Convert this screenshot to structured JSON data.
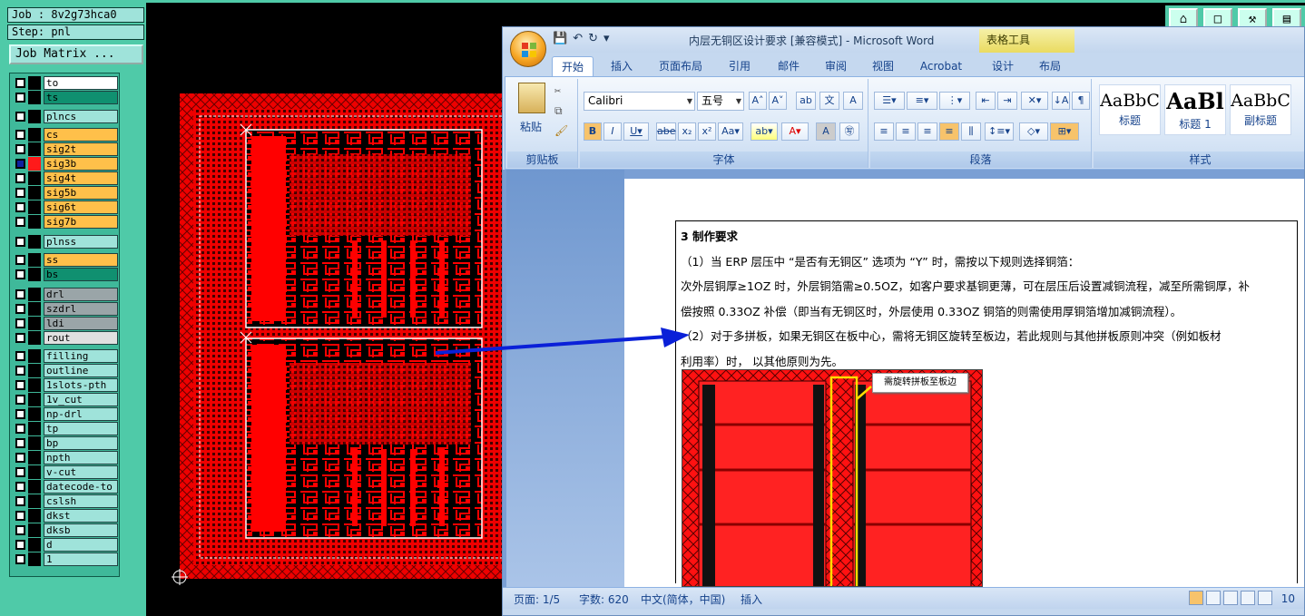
{
  "cam": {
    "job_label": "Job : 8v2g73hca0",
    "step_label": "Step: pnl",
    "job_matrix_label": "Job Matrix ...",
    "layers": [
      {
        "name": "to",
        "color": "#ffffff"
      },
      {
        "name": "ts",
        "color": "#109070"
      },
      {
        "name": "plncs",
        "color": "#9fe3da"
      },
      {
        "name": "cs",
        "color": "#ffc04a"
      },
      {
        "name": "sig2t",
        "color": "#ffc04a"
      },
      {
        "name": "sig3b",
        "color": "#ffc04a"
      },
      {
        "name": "sig4t",
        "color": "#ffc04a"
      },
      {
        "name": "sig5b",
        "color": "#ffc04a"
      },
      {
        "name": "sig6t",
        "color": "#ffc04a"
      },
      {
        "name": "sig7b",
        "color": "#ffc04a"
      },
      {
        "name": "plnss",
        "color": "#9fe3da"
      },
      {
        "name": "ss",
        "color": "#ffc04a"
      },
      {
        "name": "bs",
        "color": "#109070"
      },
      {
        "name": "drl",
        "color": "#9aa5a8"
      },
      {
        "name": "szdrl",
        "color": "#9aa5a8"
      },
      {
        "name": "ldi",
        "color": "#9aa5a8"
      },
      {
        "name": "rout",
        "color": "#e0e0e0"
      },
      {
        "name": "filling",
        "color": "#9fe3da"
      },
      {
        "name": "outline",
        "color": "#9fe3da"
      },
      {
        "name": "1slots-pth",
        "color": "#9fe3da"
      },
      {
        "name": "1v_cut",
        "color": "#9fe3da"
      },
      {
        "name": "np-drl",
        "color": "#9fe3da"
      },
      {
        "name": "tp",
        "color": "#9fe3da"
      },
      {
        "name": "bp",
        "color": "#9fe3da"
      },
      {
        "name": "npth",
        "color": "#9fe3da"
      },
      {
        "name": "v-cut",
        "color": "#9fe3da"
      },
      {
        "name": "datecode-to",
        "color": "#9fe3da"
      },
      {
        "name": "cslsh",
        "color": "#9fe3da"
      },
      {
        "name": "dkst",
        "color": "#9fe3da"
      },
      {
        "name": "dksb",
        "color": "#9fe3da"
      },
      {
        "name": "d",
        "color": "#9fe3da"
      },
      {
        "name": "1",
        "color": "#9fe3da"
      }
    ],
    "selected_layer": "sig3b"
  },
  "word": {
    "window_title": "内层无铜区设计要求 [兼容模式] - Microsoft Word",
    "context_tab": "表格工具",
    "tabs": [
      "开始",
      "插入",
      "页面布局",
      "引用",
      "邮件",
      "审阅",
      "视图",
      "Acrobat",
      "设计",
      "布局"
    ],
    "active_tab": "开始",
    "groups": {
      "clipboard": "剪贴板",
      "font": "字体",
      "paragraph": "段落",
      "styles": "样式"
    },
    "paste_label": "粘贴",
    "font_name": "Calibri",
    "font_size": "五号",
    "styles": [
      {
        "sample": "AaBbC",
        "name": "标题"
      },
      {
        "sample": "AaBl",
        "name": "标题 1"
      },
      {
        "sample": "AaBbC",
        "name": "副标题"
      }
    ],
    "document": {
      "heading": "3 制作要求",
      "para1": "（1）当 ERP 层压中 “是否有无铜区” 选项为 “Y” 时，需按以下规则选择铜箔：",
      "para2": "次外层铜厚≥1OZ 时，外层铜箔需≥0.5OZ，如客户要求基铜更薄，可在层压后设置减铜流程，减至所需铜厚，补",
      "para3": "偿按照 0.33OZ 补偿（即当有无铜区时，外层使用 0.33OZ 铜箔的则需使用厚铜箔增加减铜流程）。",
      "para4": "（2）对于多拼板，如果无铜区在板中心，需将无铜区旋转至板边，若此规则与其他拼板原则冲突（例如板材",
      "para5": "利用率）时， 以其他原则为先。",
      "callout": "需旋转拼板至板边"
    },
    "status": {
      "page": "页面: 1/5",
      "words": "字数: 620",
      "language": "中文(简体，中国)",
      "mode": "插入",
      "zoom": "10"
    }
  }
}
